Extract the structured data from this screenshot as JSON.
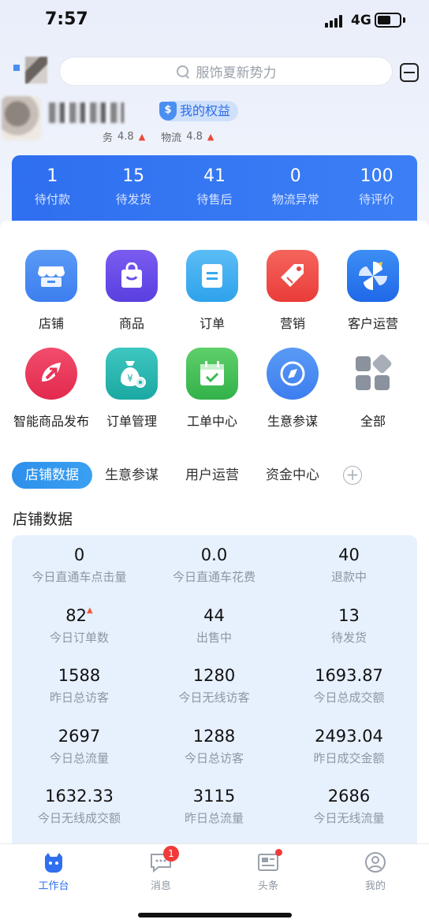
{
  "status_bar": {
    "time": "7:57",
    "network": "4G"
  },
  "header": {
    "search_placeholder": "服饰夏新势力",
    "rights_label": "我的权益",
    "rights_icon_text": "$",
    "ratings": [
      {
        "label": "务",
        "value": "4.8"
      },
      {
        "label": "物流",
        "value": "4.8"
      }
    ]
  },
  "order_stats": [
    {
      "value": "1",
      "label": "待付款"
    },
    {
      "value": "15",
      "label": "待发货"
    },
    {
      "value": "41",
      "label": "待售后"
    },
    {
      "value": "0",
      "label": "物流异常"
    },
    {
      "value": "100",
      "label": "待评价"
    }
  ],
  "apps": [
    {
      "label": "店铺",
      "icon": "store-icon"
    },
    {
      "label": "商品",
      "icon": "shopping-bag-icon"
    },
    {
      "label": "订单",
      "icon": "order-list-icon"
    },
    {
      "label": "营销",
      "icon": "tag-icon"
    },
    {
      "label": "客户运营",
      "icon": "pinwheel-icon"
    },
    {
      "label": "智能商品发布",
      "icon": "send-arrow-icon"
    },
    {
      "label": "订单管理",
      "icon": "money-bag-gear-icon"
    },
    {
      "label": "工单中心",
      "icon": "calendar-check-icon"
    },
    {
      "label": "生意参谋",
      "icon": "compass-icon"
    },
    {
      "label": "全部",
      "icon": "all-apps-grid-icon"
    }
  ],
  "tabs": [
    "店铺数据",
    "生意参谋",
    "用户运营",
    "资金中心"
  ],
  "tab_add": "+",
  "section_title": "店铺数据",
  "shop_data": [
    {
      "value": "0",
      "label": "今日直通车点击量"
    },
    {
      "value": "0.0",
      "label": "今日直通车花费"
    },
    {
      "value": "40",
      "label": "退款中"
    },
    {
      "value": "82",
      "label": "今日订单数",
      "trend": "▲"
    },
    {
      "value": "44",
      "label": "出售中"
    },
    {
      "value": "13",
      "label": "待发货"
    },
    {
      "value": "1588",
      "label": "昨日总访客"
    },
    {
      "value": "1280",
      "label": "今日无线访客"
    },
    {
      "value": "1693.87",
      "label": "今日总成交额"
    },
    {
      "value": "2697",
      "label": "今日总流量"
    },
    {
      "value": "1288",
      "label": "今日总访客"
    },
    {
      "value": "2493.04",
      "label": "昨日成交金额"
    },
    {
      "value": "1632.33",
      "label": "今日无线成交额"
    },
    {
      "value": "3115",
      "label": "昨日总流量"
    },
    {
      "value": "2686",
      "label": "今日无线流量"
    }
  ],
  "bottom_nav": [
    {
      "label": "工作台",
      "icon": "workbench-icon",
      "active": true
    },
    {
      "label": "消息",
      "icon": "message-icon",
      "badge": "1"
    },
    {
      "label": "头条",
      "icon": "news-icon",
      "dot": true
    },
    {
      "label": "我的",
      "icon": "profile-icon"
    }
  ],
  "colors": {
    "primary": "#2f6ff0",
    "badge": "#f03a3a"
  }
}
